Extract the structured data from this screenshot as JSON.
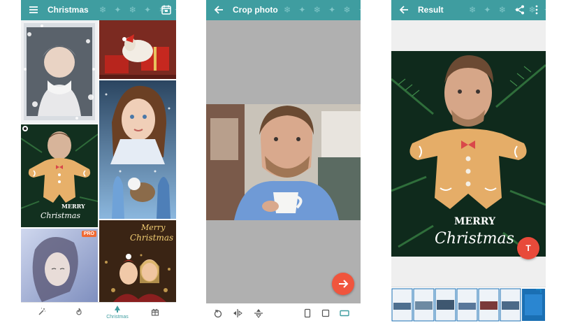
{
  "screen1": {
    "title": "Christmas",
    "pro_badge": "PRO",
    "tile3_card_line1": "MERRY",
    "tile3_card_line2": "Christmas",
    "tile6_text_line1": "Merry",
    "tile6_text_line2": "Christmas",
    "nav_items": [
      {
        "icon": "magic-wand-icon",
        "label": ""
      },
      {
        "icon": "flame-icon",
        "label": ""
      },
      {
        "icon": "christmas-tree-icon",
        "label": "Christmas"
      },
      {
        "icon": "gift-icon",
        "label": ""
      }
    ]
  },
  "screen2": {
    "title": "Crop photo",
    "tools": [
      "rotate-icon",
      "flip-horizontal-icon",
      "flip-vertical-icon",
      "aspect-portrait-icon",
      "aspect-square-icon",
      "aspect-landscape-icon"
    ]
  },
  "screen3": {
    "title": "Result",
    "card_line1": "MERRY",
    "card_line2": "Christmas",
    "fab_label": "T"
  },
  "colors": {
    "appbar": "#3f9da0",
    "fab_crop": "#f0553d",
    "fab_result": "#e84a3a",
    "selected_tool": "#3f9da0"
  }
}
